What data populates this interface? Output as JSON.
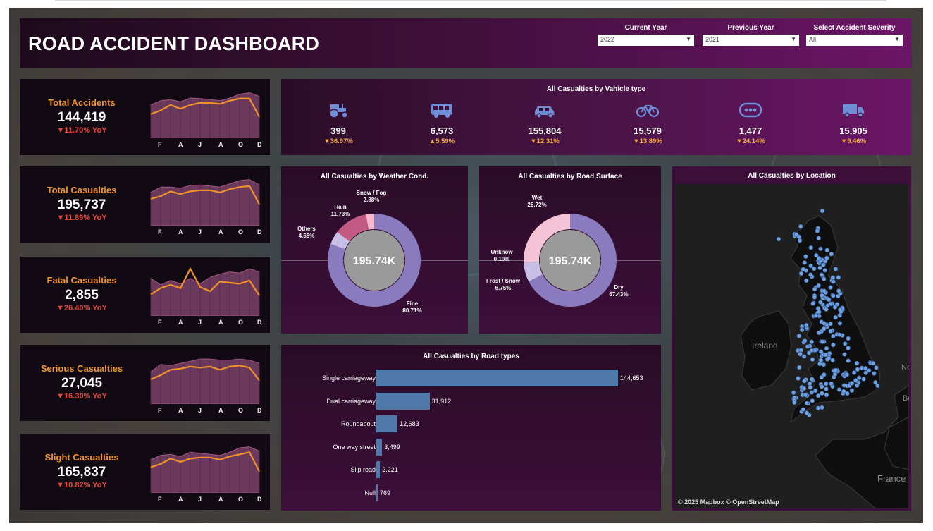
{
  "header": {
    "title": "ROAD ACCIDENT DASHBOARD",
    "filters": [
      {
        "label": "Current Year",
        "value": "2022"
      },
      {
        "label": "Previous Year",
        "value": "2021"
      },
      {
        "label": "Select Accident Severity",
        "value": "All"
      }
    ]
  },
  "months": [
    "F",
    "A",
    "J",
    "A",
    "O",
    "D"
  ],
  "kpis": [
    {
      "label": "Total Accidents",
      "value": "144,419",
      "yoy": "▼11.70% YoY",
      "current": [
        0.45,
        0.52,
        0.62,
        0.55,
        0.62,
        0.66,
        0.66,
        0.64,
        0.7,
        0.74,
        0.74,
        0.4
      ],
      "previous": [
        0.62,
        0.7,
        0.72,
        0.68,
        0.75,
        0.74,
        0.72,
        0.7,
        0.75,
        0.82,
        0.85,
        0.78
      ]
    },
    {
      "label": "Total Casualties",
      "value": "195,737",
      "yoy": "▼11.89% YoY",
      "current": [
        0.5,
        0.55,
        0.64,
        0.59,
        0.64,
        0.66,
        0.66,
        0.62,
        0.68,
        0.72,
        0.74,
        0.4
      ],
      "previous": [
        0.62,
        0.72,
        0.72,
        0.7,
        0.75,
        0.76,
        0.74,
        0.72,
        0.78,
        0.84,
        0.86,
        0.76
      ]
    },
    {
      "label": "Fatal Casualties",
      "value": "2,855",
      "yoy": "▼26.40% YoY",
      "current": [
        0.4,
        0.52,
        0.58,
        0.52,
        0.88,
        0.54,
        0.46,
        0.64,
        0.62,
        0.6,
        0.66,
        0.38
      ],
      "previous": [
        0.7,
        0.58,
        0.66,
        0.6,
        0.7,
        0.6,
        0.72,
        0.78,
        0.82,
        0.8,
        0.88,
        0.82
      ]
    },
    {
      "label": "Serious Casualties",
      "value": "27,045",
      "yoy": "▼16.30% YoY",
      "current": [
        0.46,
        0.54,
        0.64,
        0.66,
        0.7,
        0.68,
        0.7,
        0.64,
        0.7,
        0.72,
        0.68,
        0.44
      ],
      "previous": [
        0.6,
        0.74,
        0.72,
        0.76,
        0.8,
        0.84,
        0.84,
        0.82,
        0.82,
        0.84,
        0.82,
        0.76
      ]
    },
    {
      "label": "Slight Casualties",
      "value": "165,837",
      "yoy": "▼10.82% YoY",
      "current": [
        0.48,
        0.54,
        0.64,
        0.58,
        0.64,
        0.66,
        0.66,
        0.62,
        0.68,
        0.72,
        0.76,
        0.4
      ],
      "previous": [
        0.62,
        0.7,
        0.72,
        0.68,
        0.76,
        0.74,
        0.72,
        0.7,
        0.76,
        0.84,
        0.86,
        0.78
      ]
    }
  ],
  "vehicles": {
    "title": "All Casualties by Vahicle type",
    "items": [
      {
        "icon": "tractor-icon",
        "value": "399",
        "change": "▼36.97%"
      },
      {
        "icon": "bus-icon",
        "value": "6,573",
        "change": "▲5.59%"
      },
      {
        "icon": "car-icon",
        "value": "155,804",
        "change": "▼12.31%"
      },
      {
        "icon": "bicycle-icon",
        "value": "15,579",
        "change": "▼13.89%"
      },
      {
        "icon": "other-vehicle-icon",
        "value": "1,477",
        "change": "▼24.14%"
      },
      {
        "icon": "truck-icon",
        "value": "15,905",
        "change": "▼9.46%"
      }
    ]
  },
  "weather": {
    "title": "All Casualties by Weather Cond.",
    "center": "195.74K",
    "segments": [
      {
        "name": "Fine",
        "pct": "80.71%",
        "share": 80.71,
        "color": "#8a7bbf"
      },
      {
        "name": "Others",
        "pct": "4.68%",
        "share": 4.68,
        "color": "#c9bfe6"
      },
      {
        "name": "Rain",
        "pct": "11.73%",
        "share": 11.73,
        "color": "#c35a84"
      },
      {
        "name": "Snow / Fog",
        "pct": "2.88%",
        "share": 2.88,
        "color": "#f4b9cf"
      }
    ]
  },
  "surface": {
    "title": "All Casualties by Road Surface",
    "center": "195.74K",
    "segments": [
      {
        "name": "Dry",
        "pct": "67.43%",
        "share": 67.43,
        "color": "#8a7bbf"
      },
      {
        "name": "Frost / Snow",
        "pct": "6.75%",
        "share": 6.75,
        "color": "#c9bfe6"
      },
      {
        "name": "Unknow",
        "pct": "0.10%",
        "share": 0.1,
        "color": "#e8e0f5"
      },
      {
        "name": "Wet",
        "pct": "25.72%",
        "share": 25.72,
        "color": "#f5c3d6"
      }
    ]
  },
  "roadtypes": {
    "title": "All Casualties by Road types",
    "items": [
      {
        "label": "Single carriageway",
        "value": 144653,
        "text": "144,653"
      },
      {
        "label": "Dual carriageway",
        "value": 31912,
        "text": "31,912"
      },
      {
        "label": "Roundabout",
        "value": 12683,
        "text": "12,683"
      },
      {
        "label": "One way street",
        "value": 3499,
        "text": "3,499"
      },
      {
        "label": "Slip road",
        "value": 2221,
        "text": "2,221"
      },
      {
        "label": "Null",
        "value": 769,
        "text": "769"
      }
    ]
  },
  "map": {
    "title": "All Casualties by Location",
    "labels": {
      "ireland": "Ireland",
      "france": "France",
      "edge_top": "No",
      "edge_mid": "Be"
    },
    "attribution": "© 2025 Mapbox  © OpenStreetMap"
  },
  "colors": {
    "accent": "#f0922b",
    "negative": "#e8463c",
    "change": "#f2a93b",
    "bar": "#4f79a8",
    "icon": "#6f8ed6"
  }
}
